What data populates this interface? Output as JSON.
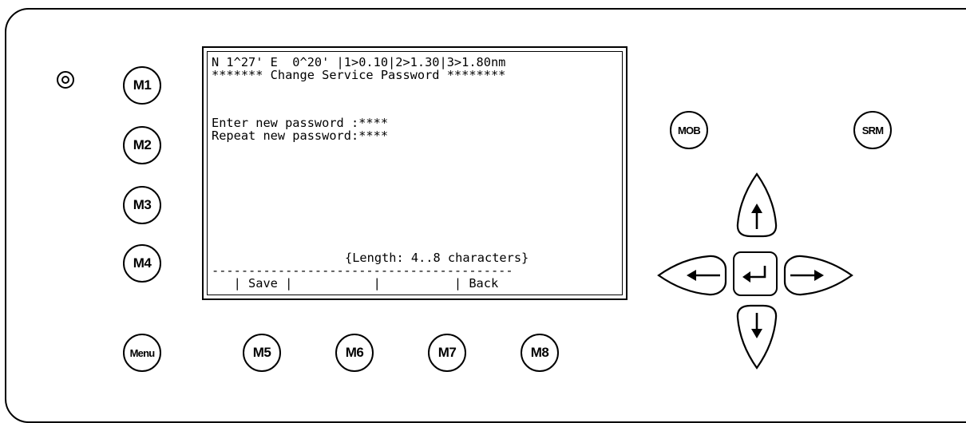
{
  "screen": {
    "status_line": "N 1^27' E  0^20' |1>0.10|2>1.30|3>1.80nm",
    "title_line": "******* Change Service Password ********",
    "new_password_line": "Enter new password :****",
    "repeat_password_line": "Repeat new password:****",
    "length_hint": "{Length: 4..8 characters}",
    "separator": "-----------------------------------------",
    "softkey_line": "   | Save |           |          | Back"
  },
  "keys": {
    "m1": "M1",
    "m2": "M2",
    "m3": "M3",
    "m4": "M4",
    "menu": "Menu",
    "m5": "M5",
    "m6": "M6",
    "m7": "M7",
    "m8": "M8",
    "mob": "MOB",
    "srm": "SRM"
  },
  "icons": {
    "led": "status-led-icon",
    "up": "arrow-up-icon",
    "down": "arrow-down-icon",
    "left": "arrow-left-icon",
    "right": "arrow-right-icon",
    "enter": "enter-icon"
  }
}
